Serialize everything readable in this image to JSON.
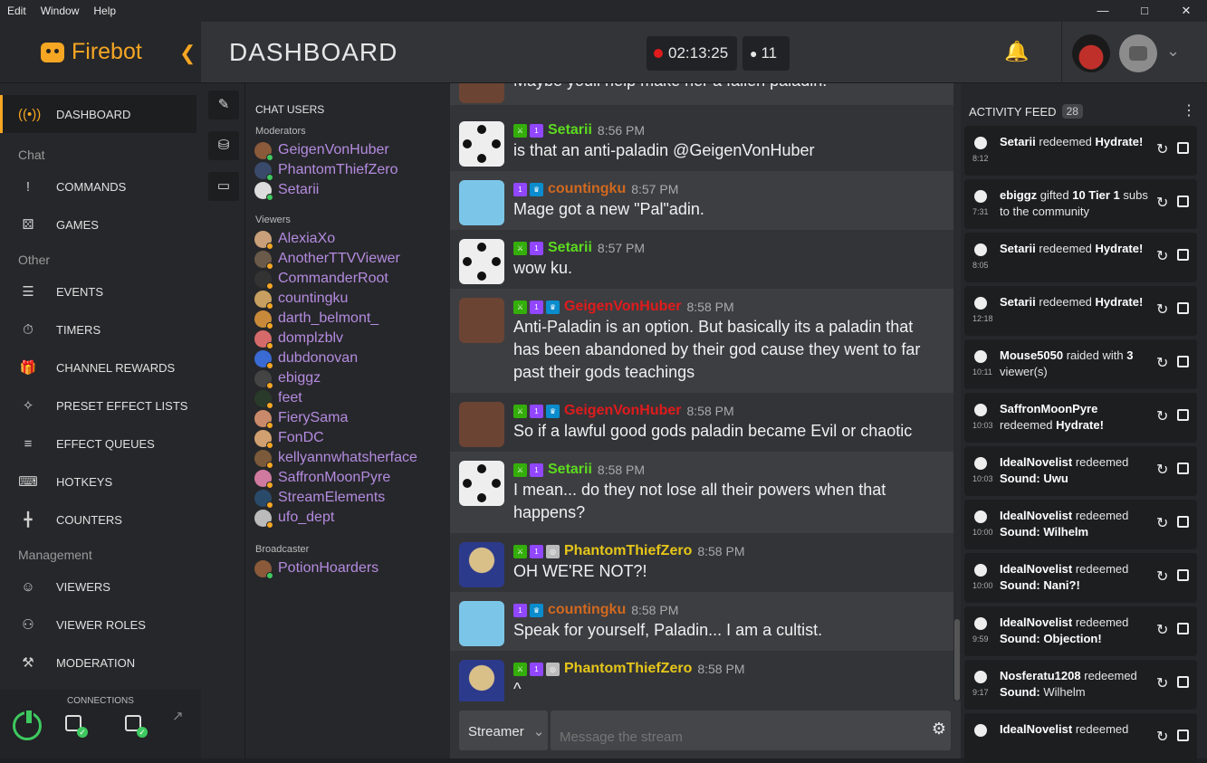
{
  "menubar": {
    "items": [
      "Edit",
      "Window",
      "Help"
    ]
  },
  "brand": {
    "name": "Firebot"
  },
  "nav": {
    "dashboard": "DASHBOARD",
    "chat_section": "Chat",
    "commands": "COMMANDS",
    "games": "GAMES",
    "other_section": "Other",
    "events": "EVENTS",
    "timers": "TIMERS",
    "channel_rewards": "CHANNEL REWARDS",
    "preset_effect_lists": "PRESET EFFECT LISTS",
    "effect_queues": "EFFECT QUEUES",
    "hotkeys": "HOTKEYS",
    "counters": "COUNTERS",
    "management_section": "Management",
    "viewers": "VIEWERS",
    "viewer_roles": "VIEWER ROLES",
    "moderation": "MODERATION"
  },
  "connections": {
    "label": "CONNECTIONS"
  },
  "header": {
    "title": "DASHBOARD",
    "stream_time": "02:13:25",
    "viewer_count": "11"
  },
  "chat_users": {
    "title": "CHAT USERS",
    "moderators_label": "Moderators",
    "moderators": [
      {
        "name": "GeigenVonHuber"
      },
      {
        "name": "PhantomThiefZero"
      },
      {
        "name": "Setarii"
      }
    ],
    "viewers_label": "Viewers",
    "viewers": [
      {
        "name": "AlexiaXo"
      },
      {
        "name": "AnotherTTVViewer"
      },
      {
        "name": "CommanderRoot"
      },
      {
        "name": "countingku"
      },
      {
        "name": "darth_belmont_"
      },
      {
        "name": "domplzblv"
      },
      {
        "name": "dubdonovan"
      },
      {
        "name": "ebiggz"
      },
      {
        "name": "feet"
      },
      {
        "name": "FierySama"
      },
      {
        "name": "FonDC"
      },
      {
        "name": "kellyannwhatsherface"
      },
      {
        "name": "SaffronMoonPyre"
      },
      {
        "name": "StreamElements"
      },
      {
        "name": "ufo_dept"
      }
    ],
    "broadcaster_label": "Broadcaster",
    "broadcaster": [
      {
        "name": "PotionHoarders"
      }
    ]
  },
  "chat": {
    "messages": [
      {
        "user": "",
        "time": "",
        "text": "Maybe youll help make her a fallen paladin!",
        "color": "#b48be0"
      },
      {
        "user": "Setarii",
        "time": "8:56 PM",
        "text": "is that an anti-paladin @GeigenVonHuber",
        "color": "#5cdb1f"
      },
      {
        "user": "countingku",
        "time": "8:57 PM",
        "text": "Mage got a new \"Pal\"adin.",
        "color": "#d2691e"
      },
      {
        "user": "Setarii",
        "time": "8:57 PM",
        "text": "wow ku.",
        "color": "#5cdb1f"
      },
      {
        "user": "GeigenVonHuber",
        "time": "8:58 PM",
        "text": "Anti-Paladin is an option. But basically its a paladin that has been abandoned by their god cause they went to far past their gods teachings",
        "color": "#e01b1b"
      },
      {
        "user": "GeigenVonHuber",
        "time": "8:58 PM",
        "text": "So if a lawful good gods paladin became Evil or chaotic",
        "color": "#e01b1b"
      },
      {
        "user": "Setarii",
        "time": "8:58 PM",
        "text": "I mean... do they not lose all their powers when that happens?",
        "color": "#5cdb1f"
      },
      {
        "user": "PhantomThiefZero",
        "time": "8:58 PM",
        "text": "OH WE'RE NOT?!",
        "color": "#e6c619"
      },
      {
        "user": "countingku",
        "time": "8:58 PM",
        "text": "Speak for yourself, Paladin... I am a cultist.",
        "color": "#d2691e"
      },
      {
        "user": "PhantomThiefZero",
        "time": "8:58 PM",
        "text": "^",
        "color": "#e6c619"
      }
    ],
    "sender": "Streamer",
    "placeholder": "Message the stream"
  },
  "activity_feed": {
    "title": "ACTIVITY FEED",
    "count": "28",
    "items": [
      {
        "user": "Setarii",
        "action": "redeemed",
        "detail": "Hydrate!",
        "time": "8:12"
      },
      {
        "user": "ebiggz",
        "action": "gifted",
        "detail": "10 Tier 1",
        "extra": "subs to the community",
        "time": "7:31"
      },
      {
        "user": "Setarii",
        "action": "redeemed",
        "detail": "Hydrate!",
        "time": "8:05"
      },
      {
        "user": "Setarii",
        "action": "redeemed",
        "detail": "Hydrate!",
        "time": "12:18"
      },
      {
        "user": "Mouse5050",
        "action": "raided with",
        "detail": "3",
        "extra": "viewer(s)",
        "time": "10:11"
      },
      {
        "user": "SaffronMoonPyre",
        "action": "redeemed",
        "detail": "Hydrate!",
        "time": "10:03"
      },
      {
        "user": "IdealNovelist",
        "action": "redeemed",
        "detail": "Sound: Uwu",
        "time": "10:03"
      },
      {
        "user": "IdealNovelist",
        "action": "redeemed",
        "detail": "Sound: Wilhelm",
        "time": "10:00"
      },
      {
        "user": "IdealNovelist",
        "action": "redeemed",
        "detail": "Sound: Nani?!",
        "time": "10:00"
      },
      {
        "user": "IdealNovelist",
        "action": "redeemed",
        "detail": "Sound: Objection!",
        "time": "9:59"
      },
      {
        "user": "Nosferatu1208",
        "action": "redeemed",
        "detail": "Sound:",
        "extra": "Wilhelm",
        "time": "9:17"
      },
      {
        "user": "IdealNovelist",
        "action": "redeemed",
        "detail": "",
        "time": ""
      }
    ]
  },
  "colors": {
    "accent": "#f5a623",
    "online": "#3ec95f",
    "recording": "#e01b1b"
  }
}
